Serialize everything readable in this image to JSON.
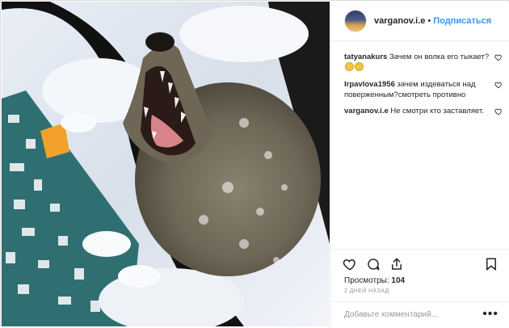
{
  "post": {
    "username": "varganov.i.e",
    "separator": "•",
    "follow_label": "Подписаться",
    "image_alt": "wolf-in-snow-video"
  },
  "comments": [
    {
      "user": "tatyanakurs",
      "text": "Зачем он волка его тыкает?",
      "emoji_count": 2
    },
    {
      "user": "lrpavlova1956",
      "text": "зачем издеваться над поверженным?смотреть противно"
    },
    {
      "user": "varganov.i.e",
      "text": "Не смотри кто заставляет."
    }
  ],
  "footer": {
    "views_label": "Просмотры:",
    "views_count": "104",
    "date": "2 ДНЕЙ НАЗАД",
    "add_comment_placeholder": "Добавьте комментарий...",
    "more_label": "•••"
  },
  "icons": {
    "like": "heart-icon",
    "comment": "comment-icon",
    "share": "share-icon",
    "save": "bookmark-icon",
    "avatar": "avatar"
  },
  "colors": {
    "follow": "#3897f0",
    "border": "#dbdbdb",
    "muted": "#999999",
    "text": "#262626"
  }
}
